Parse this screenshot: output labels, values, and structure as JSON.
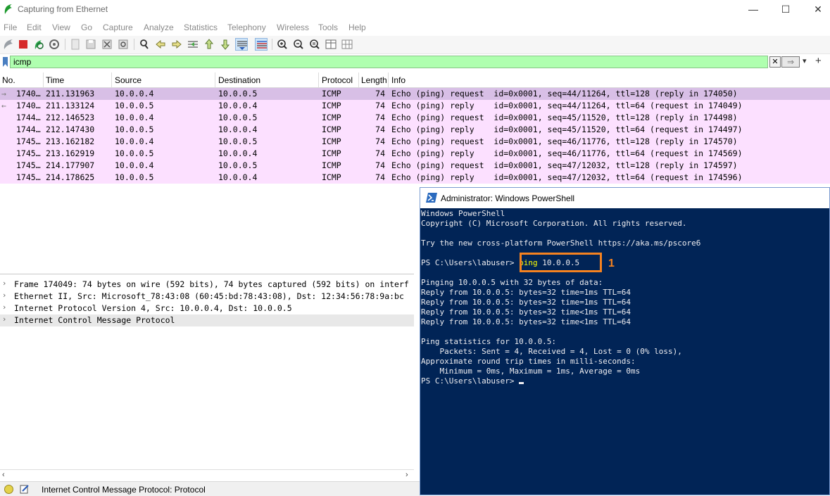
{
  "window": {
    "title": "Capturing from Ethernet",
    "min_glyph": "—",
    "max_glyph": "☐",
    "close_glyph": "✕"
  },
  "menu": [
    "File",
    "Edit",
    "View",
    "Go",
    "Capture",
    "Analyze",
    "Statistics",
    "Telephony",
    "Wireless",
    "Tools",
    "Help"
  ],
  "filter": {
    "value": "icmp",
    "clear_glyph": "✕",
    "apply_glyph": "⇒",
    "dropdown_glyph": "▾",
    "add_glyph": "+"
  },
  "columns": [
    "No.",
    "Time",
    "Source",
    "Destination",
    "Protocol",
    "Length",
    "Info"
  ],
  "packets": [
    {
      "mark": "→",
      "no": "1740…",
      "time": "211.131963",
      "src": "10.0.0.4",
      "dst": "10.0.0.5",
      "proto": "ICMP",
      "len": "74",
      "info": "Echo (ping) request  id=0x0001, seq=44/11264, ttl=128 (reply in 174050)"
    },
    {
      "mark": "←",
      "no": "1740…",
      "time": "211.133124",
      "src": "10.0.0.5",
      "dst": "10.0.0.4",
      "proto": "ICMP",
      "len": "74",
      "info": "Echo (ping) reply    id=0x0001, seq=44/11264, ttl=64 (request in 174049)"
    },
    {
      "mark": "",
      "no": "1744…",
      "time": "212.146523",
      "src": "10.0.0.4",
      "dst": "10.0.0.5",
      "proto": "ICMP",
      "len": "74",
      "info": "Echo (ping) request  id=0x0001, seq=45/11520, ttl=128 (reply in 174498)"
    },
    {
      "mark": "",
      "no": "1744…",
      "time": "212.147430",
      "src": "10.0.0.5",
      "dst": "10.0.0.4",
      "proto": "ICMP",
      "len": "74",
      "info": "Echo (ping) reply    id=0x0001, seq=45/11520, ttl=64 (request in 174497)"
    },
    {
      "mark": "",
      "no": "1745…",
      "time": "213.162182",
      "src": "10.0.0.4",
      "dst": "10.0.0.5",
      "proto": "ICMP",
      "len": "74",
      "info": "Echo (ping) request  id=0x0001, seq=46/11776, ttl=128 (reply in 174570)"
    },
    {
      "mark": "",
      "no": "1745…",
      "time": "213.162919",
      "src": "10.0.0.5",
      "dst": "10.0.0.4",
      "proto": "ICMP",
      "len": "74",
      "info": "Echo (ping) reply    id=0x0001, seq=46/11776, ttl=64 (request in 174569)"
    },
    {
      "mark": "",
      "no": "1745…",
      "time": "214.177907",
      "src": "10.0.0.4",
      "dst": "10.0.0.5",
      "proto": "ICMP",
      "len": "74",
      "info": "Echo (ping) request  id=0x0001, seq=47/12032, ttl=128 (reply in 174597)"
    },
    {
      "mark": "",
      "no": "1745…",
      "time": "214.178625",
      "src": "10.0.0.5",
      "dst": "10.0.0.4",
      "proto": "ICMP",
      "len": "74",
      "info": "Echo (ping) reply    id=0x0001, seq=47/12032, ttl=64 (request in 174596)"
    }
  ],
  "details": [
    "Frame 174049: 74 bytes on wire (592 bits), 74 bytes captured (592 bits) on interf",
    "Ethernet II, Src: Microsoft_78:43:08 (60:45:bd:78:43:08), Dst: 12:34:56:78:9a:bc",
    "Internet Protocol Version 4, Src: 10.0.0.4, Dst: 10.0.0.5",
    "Internet Control Message Protocol"
  ],
  "status": {
    "text": "Internet Control Message Protocol: Protocol"
  },
  "powershell": {
    "title": "Administrator: Windows PowerShell",
    "lines": [
      "Windows PowerShell",
      "Copyright (C) Microsoft Corporation. All rights reserved.",
      "",
      "Try the new cross-platform PowerShell https://aka.ms/pscore6",
      "",
      "",
      "",
      "Pinging 10.0.0.5 with 32 bytes of data:",
      "Reply from 10.0.0.5: bytes=32 time=1ms TTL=64",
      "Reply from 10.0.0.5: bytes=32 time=1ms TTL=64",
      "Reply from 10.0.0.5: bytes=32 time<1ms TTL=64",
      "Reply from 10.0.0.5: bytes=32 time<1ms TTL=64",
      "",
      "Ping statistics for 10.0.0.5:",
      "    Packets: Sent = 4, Received = 4, Lost = 0 (0% loss),",
      "Approximate round trip times in milli-seconds:",
      "    Minimum = 0ms, Maximum = 1ms, Average = 0ms"
    ],
    "prompt1": "PS C:\\Users\\labuser>",
    "cmd": "ping",
    "cmd_arg": "10.0.0.5",
    "prompt2": "PS C:\\Users\\labuser>",
    "annotation": "1",
    "colors": {
      "bg": "#012456",
      "text": "#eeedf0",
      "cmd": "#ffff00",
      "highlight": "#f58220"
    }
  },
  "colors": {
    "row_selected": "#d8bfe6",
    "row_icmp": "#fce0ff",
    "filter_bg": "#afffaf"
  }
}
